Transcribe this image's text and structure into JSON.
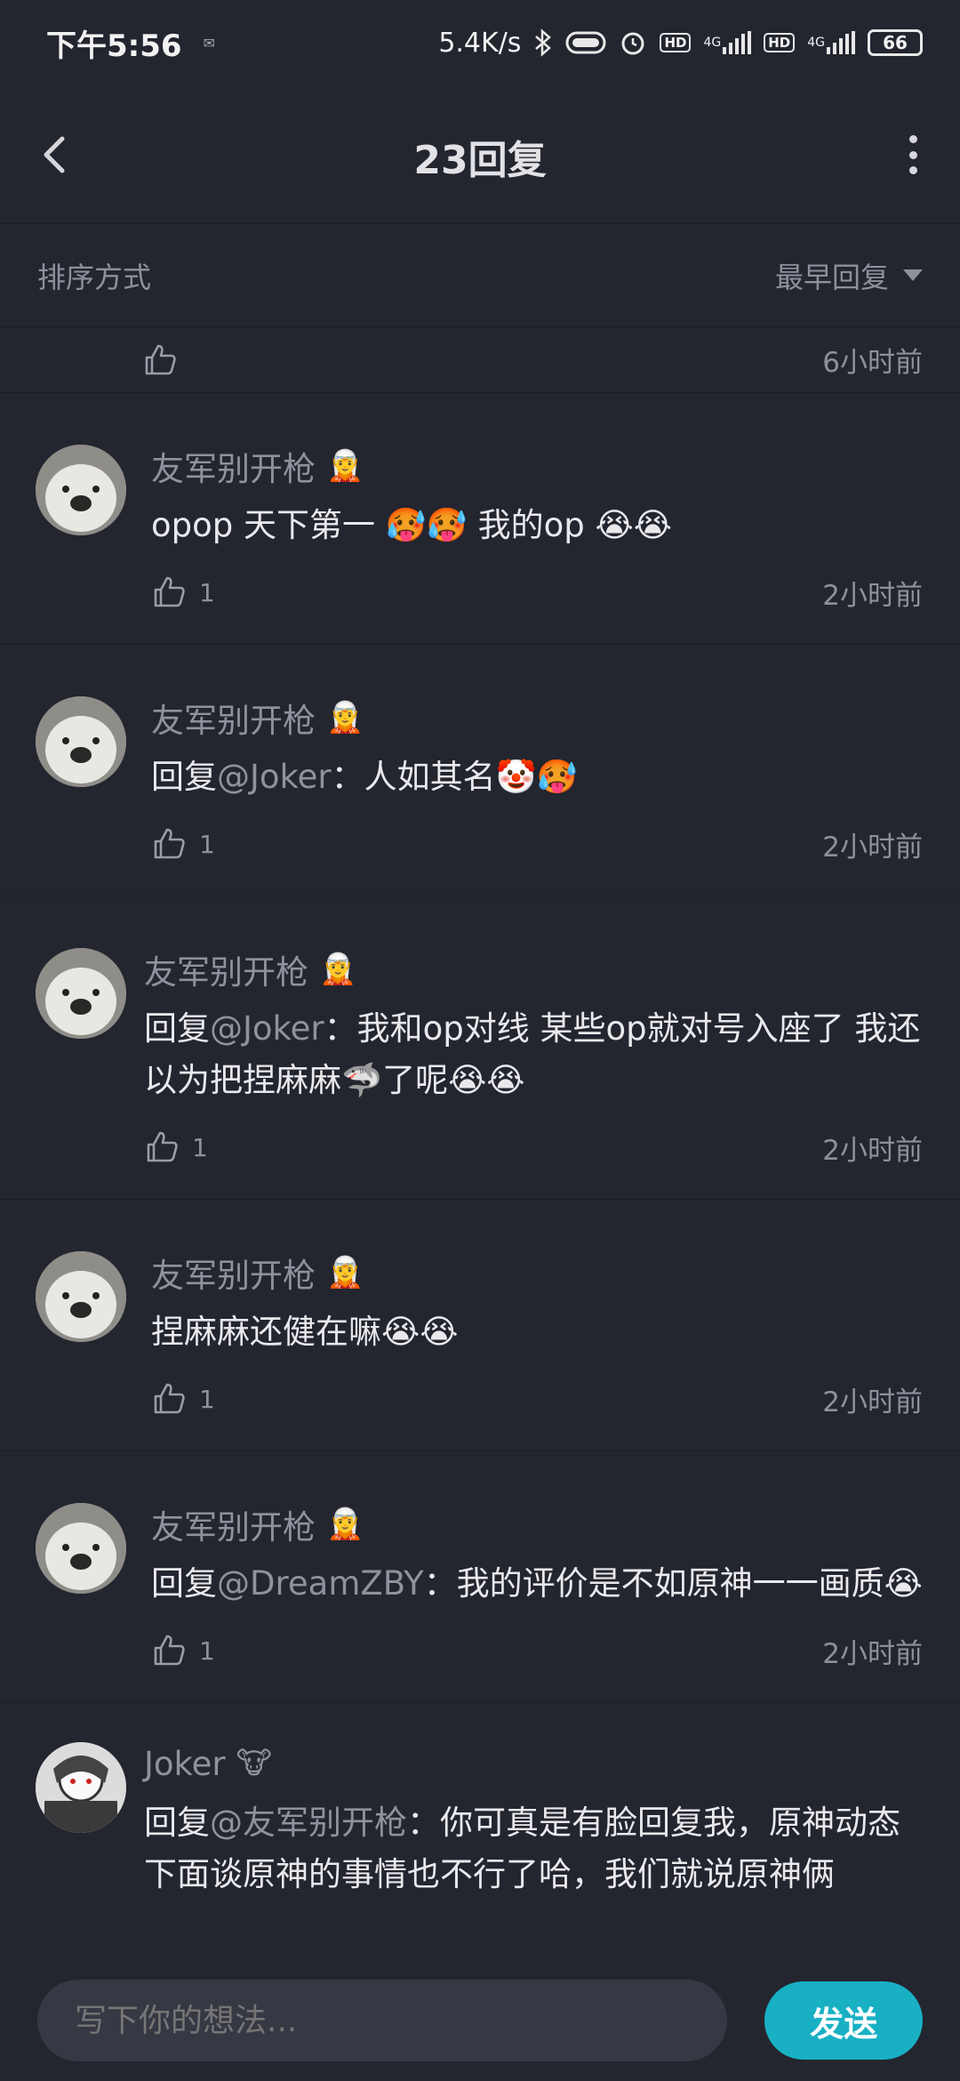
{
  "status_bar": {
    "time": "下午5:56",
    "speed": "5.4K/s",
    "hd1": "HD",
    "net1": "4G",
    "hd2": "HD",
    "net2": "4G",
    "battery": "66"
  },
  "header": {
    "title": "23回复"
  },
  "sort_bar": {
    "label": "排序方式",
    "current": "最早回复"
  },
  "partial_row": {
    "time": "6小时前"
  },
  "comments": [
    {
      "username": "友军别开枪",
      "badge": "🧝",
      "prefix": "",
      "mention": "",
      "text": "opop  天下第一 🥵🥵  我的op  😭😭",
      "likes": "1",
      "time": "2小时前"
    },
    {
      "username": "友军别开枪",
      "badge": "🧝",
      "prefix": "回复",
      "mention": "@Joker",
      "text": "：人如其名🤡🥵",
      "likes": "1",
      "time": "2小时前"
    },
    {
      "username": "友军别开枪",
      "badge": "🧝",
      "prefix": "回复",
      "mention": "@Joker",
      "text": "：我和op对线  某些op就对号入座了  我还以为把捏麻麻🦈了呢😭😭",
      "likes": "1",
      "time": "2小时前"
    },
    {
      "username": "友军别开枪",
      "badge": "🧝",
      "prefix": "",
      "mention": "",
      "text": "捏麻麻还健在嘛😭😭",
      "likes": "1",
      "time": "2小时前"
    },
    {
      "username": "友军别开枪",
      "badge": "🧝",
      "prefix": "回复",
      "mention": "@DreamZBY",
      "text": "：我的评价是不如原神一一画质😭",
      "likes": "1",
      "time": "2小时前"
    },
    {
      "username": "Joker",
      "badge": "🐮",
      "prefix": "回复",
      "mention": "@友军别开枪",
      "text": "：你可真是有脸回复我，原神动态下面谈原神的事情也不行了哈，我们就说原神俩"
    }
  ],
  "bottom_bar": {
    "placeholder": "写下你的想法...",
    "send_label": "发送"
  },
  "colors": {
    "background": "#23252f",
    "accent": "#19b0c4",
    "muted_text": "#8e909b",
    "input_bg": "#363843"
  }
}
